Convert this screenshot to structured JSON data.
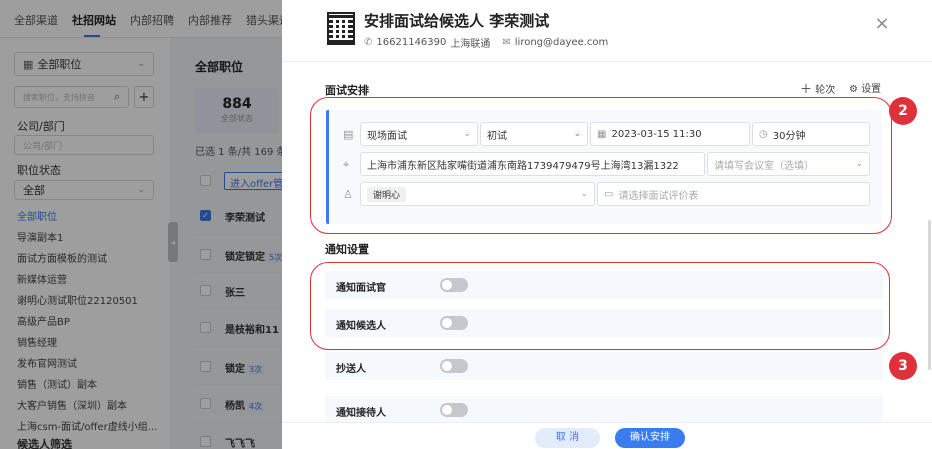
{
  "topnav": {
    "items": [
      "全部渠道",
      "社招网站",
      "内部招聘",
      "内部推荐",
      "猎头渠道"
    ]
  },
  "sidebar": {
    "position_select": "全部职位",
    "search_placeholder": "搜索职位，支持拼音",
    "add_symbol": "+",
    "dept_label": "公司/部门",
    "dept_placeholder": "公司/部门",
    "status_label": "职位状态",
    "status_value": "全部",
    "items": [
      "全部职位",
      "导演副本1",
      "面试方面模板的测试",
      "新媒体运营",
      "谢明心测试职位22120501",
      "高级产品BP",
      "销售经理",
      "发布官网测试",
      "销售（测试）副本",
      "大客户销售（深圳）副本",
      "上海csm-面试/offer虚线小组..."
    ],
    "filter_label": "候选人筛选"
  },
  "main": {
    "title": "全部职位",
    "stat_num": "884",
    "stat_label": "全部状态",
    "selected_info": "已选 1 条/共 169 条",
    "offer_button": "进入offer管理",
    "rows": [
      {
        "name": "李荣测试",
        "tag": ""
      },
      {
        "name": "锁定锁定",
        "tag": "5次"
      },
      {
        "name": "张三",
        "tag": ""
      },
      {
        "name": "是枝裕和11",
        "tag": ""
      },
      {
        "name": "锁定",
        "tag": "3次"
      },
      {
        "name": "杨凯",
        "tag": "4次"
      },
      {
        "name": "飞飞飞",
        "tag": ""
      }
    ]
  },
  "drawer": {
    "title": "安排面试给候选人   李荣测试",
    "phone": "16621146390",
    "carrier": "上海联通",
    "email": "lirong@dayee.com",
    "close_symbol": "×",
    "schedule_title": "面试安排",
    "add_round": "轮次",
    "settings": "设置",
    "interview_type": "现场面试",
    "round": "初试",
    "datetime": "2023-03-15 11:30",
    "duration": "30分钟",
    "address": "上海市浦东新区陆家嘴街道浦东南路1739479479号上海湾13漏1322",
    "room_placeholder": "请填写会议室（选填）",
    "interviewer_tag": "谢明心",
    "eval_placeholder": "请选择面试评价表",
    "notify_title": "通知设置",
    "notify_rows": [
      "通知面试官",
      "通知候选人",
      "抄送人",
      "通知接待人"
    ],
    "cancel": "取 消",
    "confirm": "确认安排"
  },
  "annotations": {
    "badge_2": "2",
    "badge_3": "3"
  },
  "colors": {
    "accent": "#3a7bf0",
    "annotation_red": "#e0303a"
  }
}
